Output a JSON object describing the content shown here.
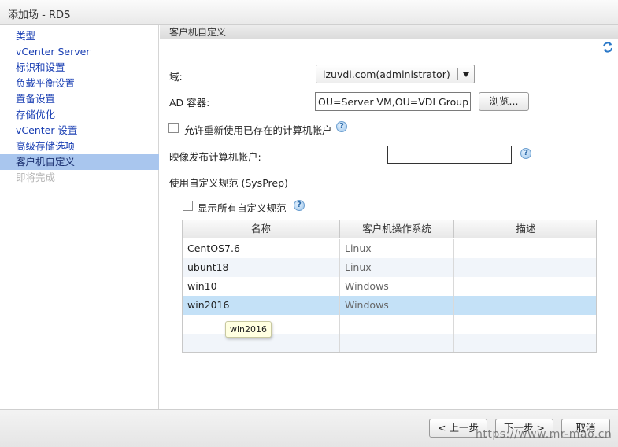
{
  "window": {
    "title": "添加场 - RDS"
  },
  "sidebar": {
    "items": [
      {
        "label": "类型",
        "state": "normal"
      },
      {
        "label": "vCenter Server",
        "state": "normal"
      },
      {
        "label": "标识和设置",
        "state": "normal"
      },
      {
        "label": "负载平衡设置",
        "state": "normal"
      },
      {
        "label": "置备设置",
        "state": "normal"
      },
      {
        "label": "存储优化",
        "state": "normal"
      },
      {
        "label": "vCenter 设置",
        "state": "normal"
      },
      {
        "label": "高级存储选项",
        "state": "normal"
      },
      {
        "label": "客户机自定义",
        "state": "active"
      },
      {
        "label": "即将完成",
        "state": "disabled"
      }
    ]
  },
  "content": {
    "header": "客户机自定义",
    "refresh_icon": "refresh-icon",
    "domain_label": "域:",
    "domain_value": "lzuvdi.com(administrator)",
    "ad_label": "AD 容器:",
    "ad_value": "OU=Server VM,OU=VDI Group",
    "browse_label": "浏览...",
    "reuse_label": "允许重新使用已存在的计算机帐户",
    "image_publish_label": "映像发布计算机帐户:",
    "image_publish_value": "",
    "sysprep_label": "使用自定义规范 (SysPrep)",
    "show_all_label": "显示所有自定义规范",
    "help_glyph": "?",
    "table": {
      "columns": [
        "名称",
        "客户机操作系统",
        "描述"
      ],
      "rows": [
        {
          "name": "CentOS7.6",
          "os": "Linux",
          "desc": ""
        },
        {
          "name": "ubunt18",
          "os": "Linux",
          "desc": ""
        },
        {
          "name": "win10",
          "os": "Windows",
          "desc": ""
        },
        {
          "name": "win2016",
          "os": "Windows",
          "desc": ""
        }
      ],
      "selected_index": 3,
      "tooltip": "win2016"
    }
  },
  "footer": {
    "back_label": "< 上一步",
    "next_label": "下一步 >",
    "cancel_label": "取消"
  },
  "watermark": "https://www.mr-mao.cn"
}
